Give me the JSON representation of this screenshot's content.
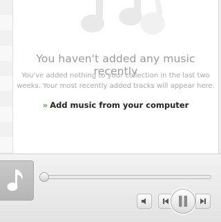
{
  "empty_state": {
    "headline": "You haven't added any music recently",
    "subtext_line1": "You've added nothing to your collection in the last two",
    "subtext_line2": "weeks. Your most recently added tracks will appear here.",
    "action_arrow": "»",
    "action_label": "Add music from your computer"
  },
  "player": {
    "progress": 0,
    "icons": {
      "album_art": "music-note-icon",
      "volume": "speaker-icon",
      "previous": "skip-back-icon",
      "play_pause": "pause-icon",
      "next": "skip-forward-icon"
    }
  },
  "colors": {
    "link_arrow": "#4aa13a",
    "headline": "#9a9a9a"
  }
}
